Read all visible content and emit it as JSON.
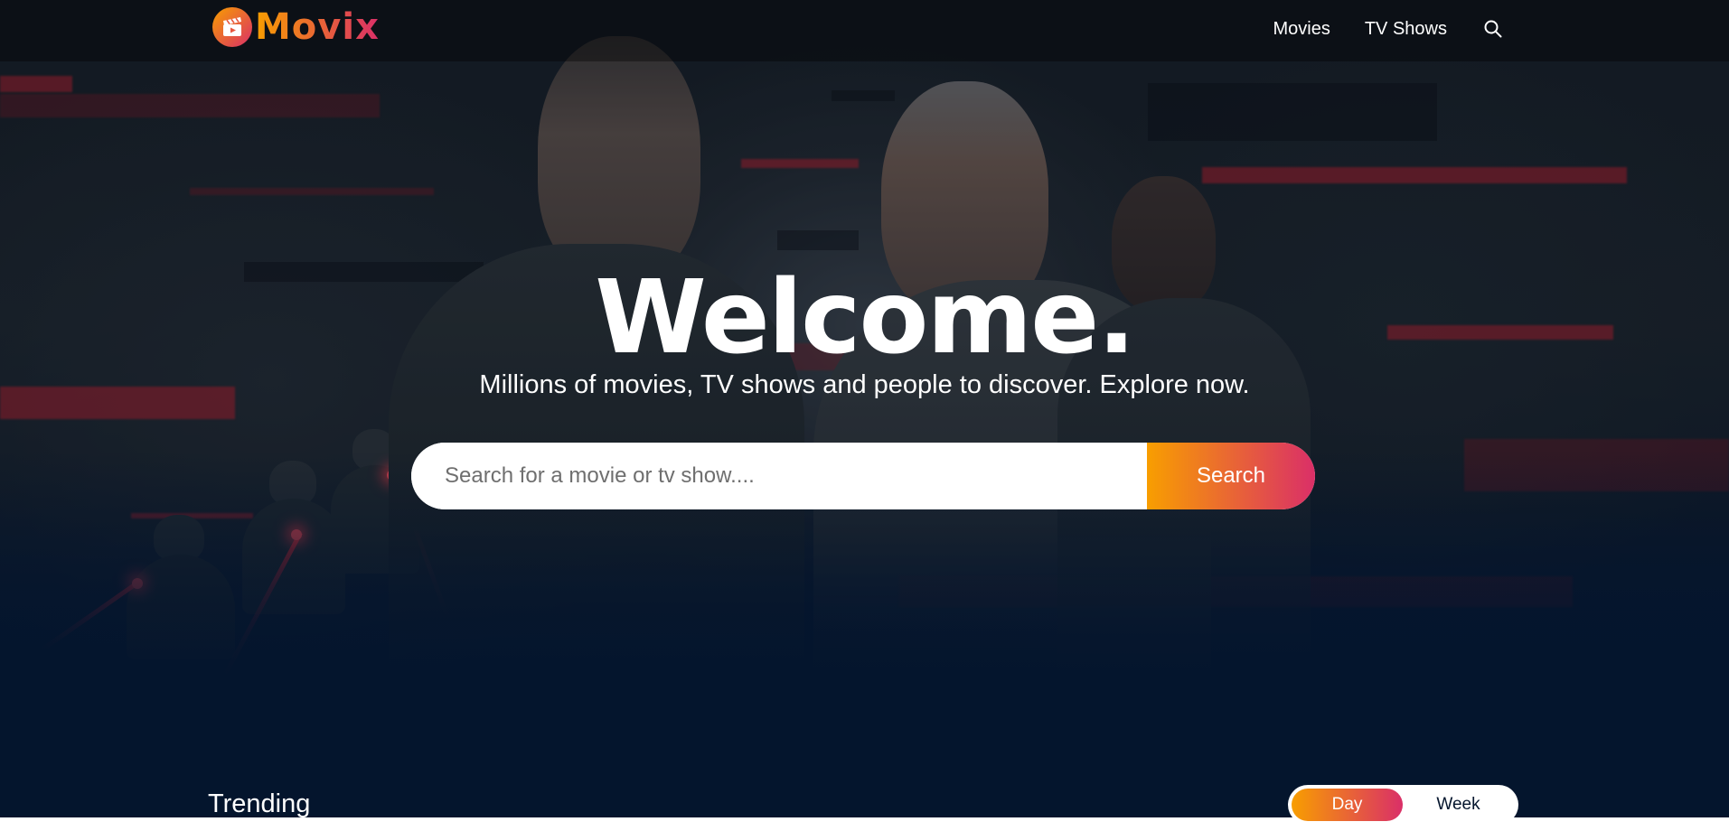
{
  "header": {
    "logo_text": "Movix",
    "nav": {
      "movies_label": "Movies",
      "tv_shows_label": "TV Shows",
      "search_icon": "search-icon"
    }
  },
  "hero": {
    "title": "Welcome.",
    "subtitle": "Millions of movies, TV shows and people to discover. Explore now.",
    "search": {
      "placeholder": "Search for a movie or tv show....",
      "value": "",
      "button_label": "Search"
    }
  },
  "trending": {
    "title": "Trending",
    "tabs": [
      {
        "label": "Day",
        "active": true
      },
      {
        "label": "Week",
        "active": false
      }
    ]
  },
  "colors": {
    "background": "#04152d",
    "gradient_start": "#f89e00",
    "gradient_end": "#da2f68"
  }
}
